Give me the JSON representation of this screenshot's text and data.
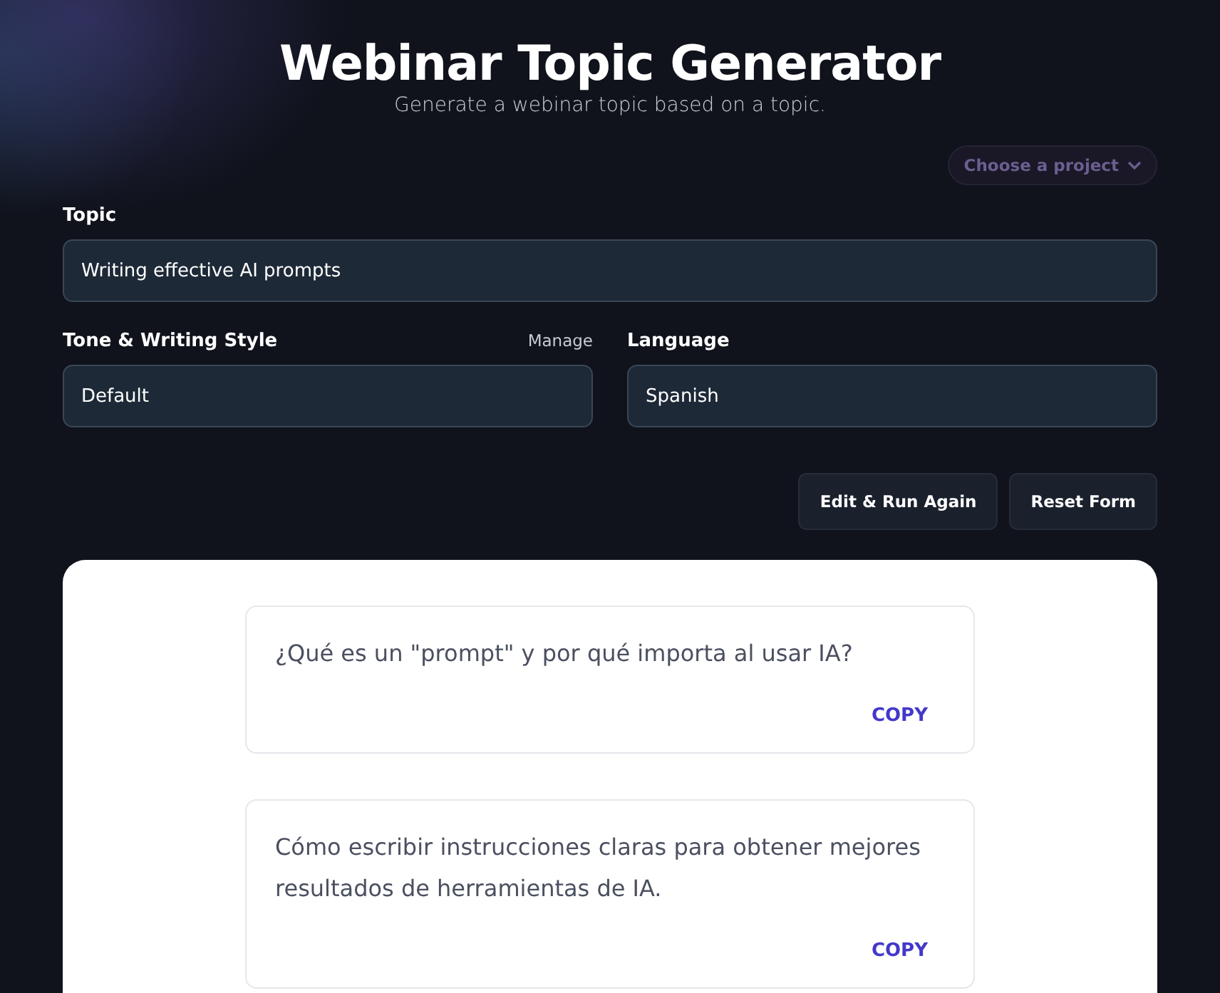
{
  "header": {
    "title": "Webinar Topic Generator",
    "subtitle": "Generate a webinar topic based on a topic."
  },
  "project_select": {
    "placeholder": "Choose a project"
  },
  "form": {
    "topic": {
      "label": "Topic",
      "value": "Writing effective AI prompts"
    },
    "tone": {
      "label": "Tone & Writing Style",
      "link": "Manage",
      "value": "Default"
    },
    "language": {
      "label": "Language",
      "value": "Spanish"
    }
  },
  "buttons": [
    "Edit & Run Again",
    "Reset Form"
  ],
  "results": [
    {
      "text": "¿Qué es un \"prompt\" y por qué importa al usar IA?",
      "action": "COPY"
    },
    {
      "text": "Cómo escribir instrucciones claras para obtener mejores resultados de herramientas de IA.",
      "action": "COPY"
    }
  ]
}
